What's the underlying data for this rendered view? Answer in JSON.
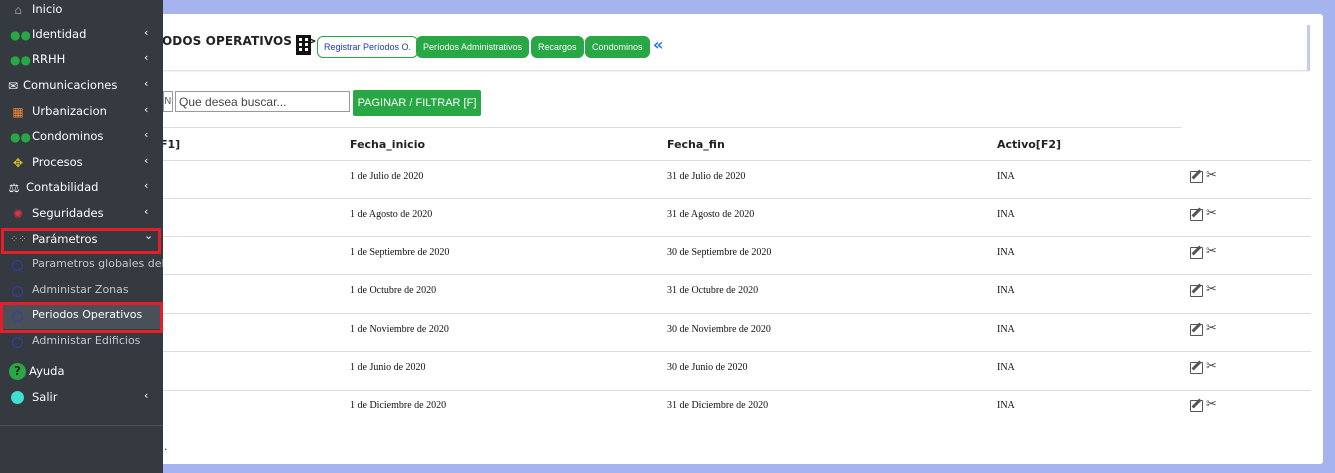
{
  "header": {
    "title": "ODOS OPERATIVOS >>",
    "buttons": [
      "Registrar Períodos O.",
      "Períodos Administrativos",
      "Recargos",
      "Condominos"
    ],
    "collapse_glyph": "«"
  },
  "search": {
    "small_box_text": "N",
    "placeholder": "Que desea buscar...",
    "filter_button": "PAGINAR / FILTRAR [F]"
  },
  "table": {
    "columns": [
      "F1]",
      "Fecha_inicio",
      "Fecha_fin",
      "Activo[F2]"
    ],
    "rows": [
      {
        "inicio": "1 de Julio de 2020",
        "fin": "31 de Julio de 2020",
        "activo": "INA"
      },
      {
        "inicio": "1 de Agosto de 2020",
        "fin": "31 de Agosto de 2020",
        "activo": "INA"
      },
      {
        "inicio": "1 de Septiembre de 2020",
        "fin": "30 de Septiembre de 2020",
        "activo": "INA"
      },
      {
        "inicio": "1 de Octubre de 2020",
        "fin": "31 de Octubre de 2020",
        "activo": "INA"
      },
      {
        "inicio": "1 de Noviembre de 2020",
        "fin": "30 de Noviembre de 2020",
        "activo": "INA"
      },
      {
        "inicio": "1 de Junio de 2020",
        "fin": "30 de Junio de 2020",
        "activo": "INA"
      },
      {
        "inicio": "1 de Diciembre de 2020",
        "fin": "31 de Diciembre de 2020",
        "activo": "INA"
      }
    ],
    "footer_text": "."
  },
  "sidebar": {
    "items": [
      {
        "label": "Inicio",
        "icon": "home-icon",
        "arrow": ""
      },
      {
        "label": "Identidad",
        "icon": "users-icon",
        "arrow": "‹"
      },
      {
        "label": "RRHH",
        "icon": "users-icon",
        "arrow": "‹"
      },
      {
        "label": "Comunicaciones",
        "icon": "envelope-open-icon",
        "arrow": "‹"
      },
      {
        "label": "Urbanizacion",
        "icon": "building-icon",
        "arrow": "‹"
      },
      {
        "label": "Condominos",
        "icon": "users-icon",
        "arrow": "‹"
      },
      {
        "label": "Procesos",
        "icon": "arrows-icon",
        "arrow": "‹"
      },
      {
        "label": "Contabilidad",
        "icon": "balance-scale-icon",
        "arrow": "‹"
      },
      {
        "label": "Seguridades",
        "icon": "brain-icon",
        "arrow": "‹"
      },
      {
        "label": "Parámetros",
        "icon": "grid-dots-icon",
        "arrow": "⌄"
      },
      {
        "label": "Parametros globales del s",
        "icon": "circle-icon",
        "arrow": ""
      },
      {
        "label": "Administar Zonas",
        "icon": "circle-icon",
        "arrow": ""
      },
      {
        "label": "Periodos Operativos",
        "icon": "circle-icon",
        "arrow": ""
      },
      {
        "label": "Administar Edificios",
        "icon": "circle-icon",
        "arrow": ""
      },
      {
        "label": "Ayuda",
        "icon": "question-icon",
        "arrow": ""
      },
      {
        "label": "Salir",
        "icon": "circle-icon",
        "arrow": "‹"
      }
    ],
    "colors": {
      "background": "#343a40",
      "highlight": "#e3202a",
      "accent": "#28a745"
    }
  }
}
